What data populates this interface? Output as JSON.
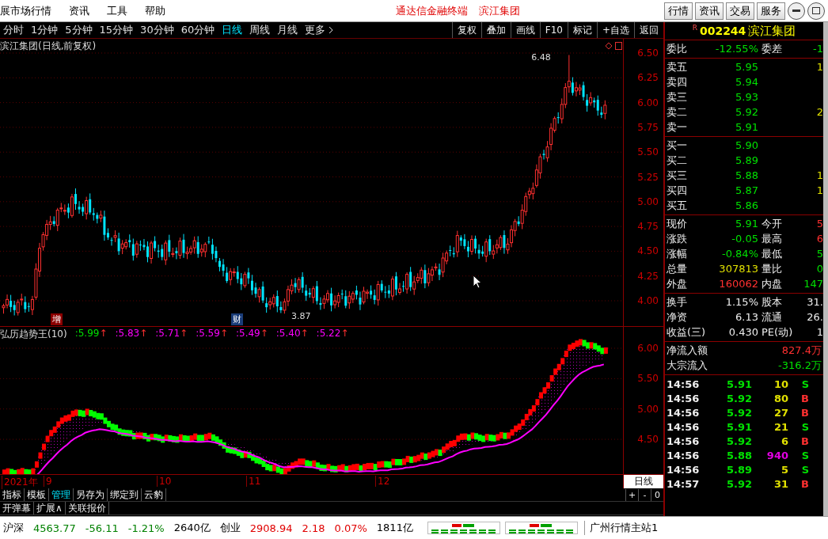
{
  "menu_bar": {
    "items": [
      "展市场行情",
      "资讯",
      "工具",
      "帮助"
    ],
    "title": "通达信金融终端",
    "stock": "滨江集团",
    "buttons": [
      "行情",
      "资讯",
      "交易",
      "服务"
    ]
  },
  "period_bar": {
    "periods": [
      {
        "label": "分时",
        "selected": false
      },
      {
        "label": "1分钟",
        "selected": false
      },
      {
        "label": "5分钟",
        "selected": false
      },
      {
        "label": "15分钟",
        "selected": false
      },
      {
        "label": "30分钟",
        "selected": false
      },
      {
        "label": "60分钟",
        "selected": false
      },
      {
        "label": "日线",
        "selected": true
      },
      {
        "label": "周线",
        "selected": false
      },
      {
        "label": "月线",
        "selected": false
      }
    ],
    "more": "更多",
    "tools": [
      "复权",
      "叠加",
      "画线",
      "F10",
      "标记",
      "+自选",
      "返回"
    ]
  },
  "main_chart": {
    "title": "滨江集团(日线,前复权)",
    "price_axis": [
      "6.50",
      "6.25",
      "6.00",
      "5.75",
      "5.50",
      "5.25",
      "5.00",
      "4.75",
      "4.50",
      "4.25",
      "4.00"
    ],
    "high_label": "6.48",
    "low_label": "3.87",
    "markers": [
      {
        "text": "增",
        "color": "#8b0000"
      },
      {
        "text": "财",
        "color": "#1a3c78"
      }
    ]
  },
  "indicator": {
    "name": "弘历趋势王(10)",
    "axis": [
      "6.00",
      "5.50",
      "5.00",
      "4.50"
    ],
    "values": [
      {
        "text": ":5.99",
        "arrow": "↑",
        "color": "#00e000"
      },
      {
        "text": ":5.83",
        "arrow": "↑",
        "color": "#ff00ff"
      },
      {
        "text": ":5.71",
        "arrow": "↑",
        "color": "#ff00ff"
      },
      {
        "text": ":5.59",
        "arrow": "↑",
        "color": "#ff00ff"
      },
      {
        "text": ":5.49",
        "arrow": "↑",
        "color": "#ff00ff"
      },
      {
        "text": ":5.40",
        "arrow": "↑",
        "color": "#ff00ff"
      },
      {
        "text": ":5.22",
        "arrow": "↑",
        "color": "#ff00ff"
      }
    ]
  },
  "x_axis": {
    "labels": [
      "2021年",
      "9",
      "10",
      "11",
      "12"
    ],
    "period": "日线"
  },
  "tabs": [
    {
      "label": "指标",
      "selected": false
    },
    {
      "label": "模板",
      "selected": false
    },
    {
      "label": "管理",
      "selected": true
    },
    {
      "label": "另存为",
      "selected": false
    },
    {
      "label": "绑定到",
      "selected": false
    },
    {
      "label": "云豹",
      "selected": false
    }
  ],
  "zoom_buttons": [
    "+",
    "-",
    "0"
  ],
  "tabs_row2": [
    "开弹幕",
    "扩展∧",
    "关联报价"
  ],
  "quote": {
    "flag": "R",
    "code": "002244",
    "name": "滨江集团",
    "ratio": [
      {
        "label": "委比",
        "value": "-12.55%",
        "color": "#00e000"
      },
      {
        "label": "委差",
        "value": "-1",
        "color": "#00e000"
      }
    ],
    "sells": [
      {
        "label": "卖五",
        "price": "5.95",
        "volume": "1"
      },
      {
        "label": "卖四",
        "price": "5.94"
      },
      {
        "label": "卖三",
        "price": "5.93"
      },
      {
        "label": "卖二",
        "price": "5.92",
        "volume": "2"
      },
      {
        "label": "卖一",
        "price": "5.91"
      }
    ],
    "buys": [
      {
        "label": "买一",
        "price": "5.90"
      },
      {
        "label": "买二",
        "price": "5.89"
      },
      {
        "label": "买三",
        "price": "5.88",
        "volume": "1"
      },
      {
        "label": "买四",
        "price": "5.87",
        "volume": "1"
      },
      {
        "label": "买五",
        "price": "5.86"
      }
    ],
    "stats": [
      {
        "label": "现价",
        "value": "5.91",
        "color": "#00e000"
      },
      {
        "label": "今开",
        "value": "5",
        "color": "#ff3030"
      },
      {
        "label": "涨跌",
        "value": "-0.05",
        "color": "#00e000"
      },
      {
        "label": "最高",
        "value": "6",
        "color": "#ff3030"
      },
      {
        "label": "涨幅",
        "value": "-0.84%",
        "color": "#00e000"
      },
      {
        "label": "最低",
        "value": "5",
        "color": "#00e000"
      },
      {
        "label": "总量",
        "value": "307813",
        "color": "#e0e000"
      },
      {
        "label": "量比",
        "value": "0",
        "color": "#00e000"
      },
      {
        "label": "外盘",
        "value": "160062",
        "color": "#ff3030"
      },
      {
        "label": "内盘",
        "value": "147",
        "color": "#00e000"
      }
    ],
    "fundamentals": [
      {
        "label": "换手",
        "value": "1.15%"
      },
      {
        "label": "股本",
        "value": "31."
      },
      {
        "label": "净资",
        "value": "6.13"
      },
      {
        "label": "流通",
        "value": "26."
      },
      {
        "label": "收益(三)",
        "value": "0.430"
      },
      {
        "label": "PE(动)",
        "value": "1"
      }
    ],
    "flows": [
      {
        "label": "净流入额",
        "value": "827.4万",
        "color": "#ff3030"
      },
      {
        "label": "大宗流入",
        "value": "-316.2万",
        "color": "#00e000"
      }
    ],
    "trades": [
      {
        "time": "14:56",
        "price": "5.91",
        "volume": {
          "text": "10",
          "color": "#e0e000"
        },
        "side": {
          "text": "S",
          "color": "#00e000"
        }
      },
      {
        "time": "14:56",
        "price": "5.92",
        "volume": {
          "text": "80",
          "color": "#e0e000"
        },
        "side": {
          "text": "B",
          "color": "#ff3030"
        }
      },
      {
        "time": "14:56",
        "price": "5.92",
        "volume": {
          "text": "27",
          "color": "#e0e000"
        },
        "side": {
          "text": "B",
          "color": "#ff3030"
        }
      },
      {
        "time": "14:56",
        "price": "5.91",
        "volume": {
          "text": "21",
          "color": "#e0e000"
        },
        "side": {
          "text": "S",
          "color": "#00e000"
        }
      },
      {
        "time": "14:56",
        "price": "5.92",
        "volume": {
          "text": "6",
          "color": "#e0e000"
        },
        "side": {
          "text": "B",
          "color": "#ff3030"
        }
      },
      {
        "time": "14:56",
        "price": "5.88",
        "volume": {
          "text": "940",
          "color": "#e000e0"
        },
        "side": {
          "text": "S",
          "color": "#00e000"
        }
      },
      {
        "time": "14:56",
        "price": "5.89",
        "volume": {
          "text": "5",
          "color": "#e0e000"
        },
        "side": {
          "text": "S",
          "color": "#00e000"
        }
      },
      {
        "time": "14:57",
        "price": "5.92",
        "volume": {
          "text": "31",
          "color": "#e0e000"
        },
        "side": {
          "text": "B",
          "color": "#ff3030"
        }
      }
    ]
  },
  "status_bar": {
    "items": [
      {
        "text": "沪深"
      },
      {
        "text": "4563.77",
        "color": "#008000"
      },
      {
        "text": "-56.11",
        "color": "#008000"
      },
      {
        "text": "-1.21%",
        "color": "#008000"
      },
      {
        "text": "2640亿"
      },
      {
        "text": "创业"
      },
      {
        "text": "2908.94",
        "color": "#e00000"
      },
      {
        "text": "2.18",
        "color": "#e00000"
      },
      {
        "text": "0.07%",
        "color": "#e00000"
      },
      {
        "text": "1811亿"
      }
    ],
    "server": "广州行情主站1"
  }
}
